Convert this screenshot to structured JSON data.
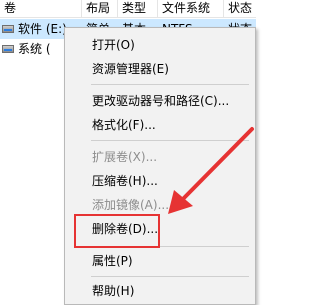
{
  "columns": [
    "卷",
    "布局",
    "类型",
    "文件系统",
    "状态"
  ],
  "volumes": [
    {
      "name": "软件 (E:)",
      "layout": "简单",
      "type": "基本",
      "fs": "NTFS",
      "status": "状态"
    },
    {
      "name": "系统 ("
    }
  ],
  "menu": {
    "open": "打开(O)",
    "explore": "资源管理器(E)",
    "change_drive": "更改驱动器号和路径(C)...",
    "format": "格式化(F)...",
    "extend": "扩展卷(X)...",
    "shrink": "压缩卷(H)...",
    "add_mirror": "添加镜像(A)...",
    "delete": "删除卷(D)...",
    "properties": "属性(P)",
    "help": "帮助(H)"
  },
  "colors": {
    "selection": "#cce8ff",
    "annotation": "#e63333",
    "menu_bg": "#f2f2f2"
  }
}
